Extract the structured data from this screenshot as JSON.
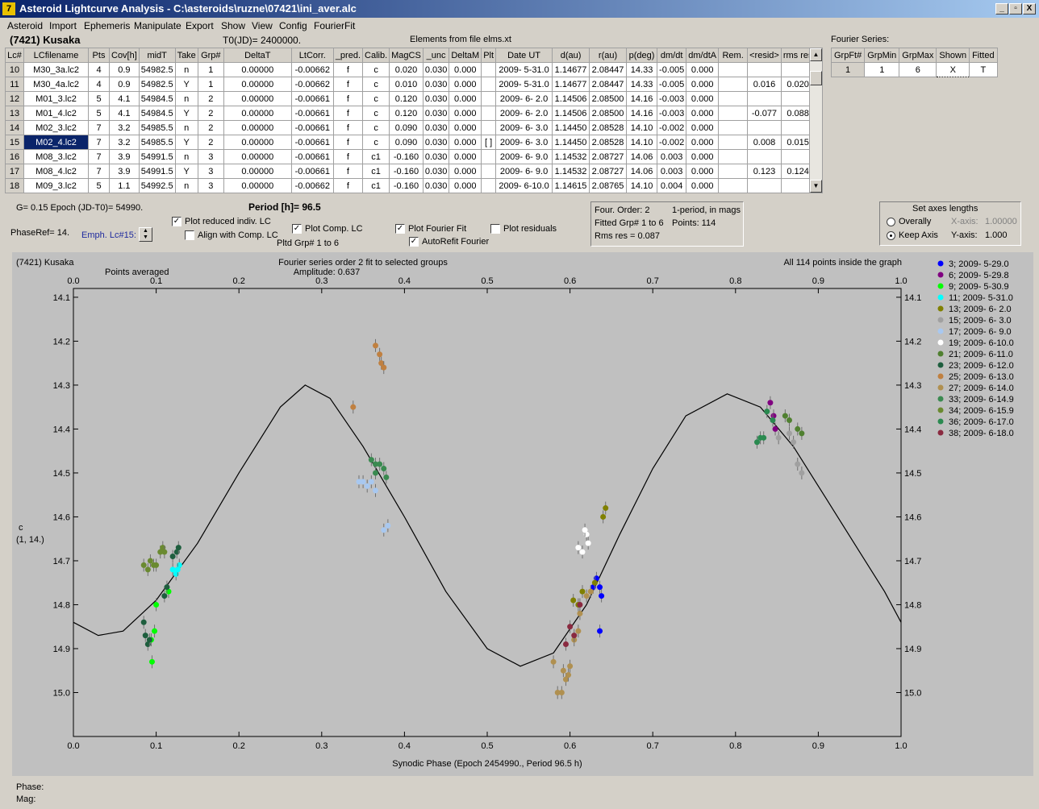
{
  "window": {
    "title": "Asteroid Lightcurve Analysis - C:\\asteroids\\ruzne\\07421\\ini_aver.alc",
    "minimize": "_",
    "maximize": "▫",
    "close": "X"
  },
  "menu": [
    "Asteroid",
    "Import",
    "Ephemeris",
    "Manipulate",
    "Export",
    "Show",
    "View",
    "Config",
    "FourierFit"
  ],
  "header": {
    "asteroid": "(7421) Kusaka",
    "t0": "T0(JD)= 2400000.",
    "elements": "Elements from file elms.xt",
    "fourier_series_label": "Fourier Series:"
  },
  "table": {
    "columns": [
      "Lc#",
      "LCfilename",
      "Pts",
      "Cov[h]",
      "midT",
      "Take",
      "Grp#",
      "DeltaT",
      "LtCorr.",
      "_pred.",
      "Calib.",
      "MagCS",
      "_unc",
      "DeltaM",
      "Plt",
      "Date UT",
      "d(au)",
      "r(au)",
      "p(deg)",
      "dm/dt",
      "dm/dtA",
      "Rem.",
      "<resid>",
      "rms res"
    ],
    "rows": [
      [
        "10",
        "M30_3a.lc2",
        "4",
        "0.9",
        "54982.5",
        "n",
        "1",
        "0.00000",
        "-0.00662",
        "f",
        "c",
        "0.020",
        "0.030",
        "0.000",
        "",
        "2009- 5-31.0",
        "1.14677",
        "2.08447",
        "14.33",
        "-0.005",
        "0.000",
        "",
        "",
        ""
      ],
      [
        "11",
        "M30_4a.lc2",
        "4",
        "0.9",
        "54982.5",
        "Y",
        "1",
        "0.00000",
        "-0.00662",
        "f",
        "c",
        "0.010",
        "0.030",
        "0.000",
        "",
        "2009- 5-31.0",
        "1.14677",
        "2.08447",
        "14.33",
        "-0.005",
        "0.000",
        "",
        "0.016",
        "0.020"
      ],
      [
        "12",
        "M01_3.lc2",
        "5",
        "4.1",
        "54984.5",
        "n",
        "2",
        "0.00000",
        "-0.00661",
        "f",
        "c",
        "0.120",
        "0.030",
        "0.000",
        "",
        "2009- 6- 2.0",
        "1.14506",
        "2.08500",
        "14.16",
        "-0.003",
        "0.000",
        "",
        "",
        ""
      ],
      [
        "13",
        "M01_4.lc2",
        "5",
        "4.1",
        "54984.5",
        "Y",
        "2",
        "0.00000",
        "-0.00661",
        "f",
        "c",
        "0.120",
        "0.030",
        "0.000",
        "",
        "2009- 6- 2.0",
        "1.14506",
        "2.08500",
        "14.16",
        "-0.003",
        "0.000",
        "",
        "-0.077",
        "0.088"
      ],
      [
        "14",
        "M02_3.lc2",
        "7",
        "3.2",
        "54985.5",
        "n",
        "2",
        "0.00000",
        "-0.00661",
        "f",
        "c",
        "0.090",
        "0.030",
        "0.000",
        "",
        "2009- 6- 3.0",
        "1.14450",
        "2.08528",
        "14.10",
        "-0.002",
        "0.000",
        "",
        "",
        ""
      ],
      [
        "15",
        "M02_4.lc2",
        "7",
        "3.2",
        "54985.5",
        "Y",
        "2",
        "0.00000",
        "-0.00661",
        "f",
        "c",
        "0.090",
        "0.030",
        "0.000",
        "[ ]",
        "2009- 6- 3.0",
        "1.14450",
        "2.08528",
        "14.10",
        "-0.002",
        "0.000",
        "",
        "0.008",
        "0.015"
      ],
      [
        "16",
        "M08_3.lc2",
        "7",
        "3.9",
        "54991.5",
        "n",
        "3",
        "0.00000",
        "-0.00661",
        "f",
        "c1",
        "-0.160",
        "0.030",
        "0.000",
        "",
        "2009- 6- 9.0",
        "1.14532",
        "2.08727",
        "14.06",
        "0.003",
        "0.000",
        "",
        "",
        ""
      ],
      [
        "17",
        "M08_4.lc2",
        "7",
        "3.9",
        "54991.5",
        "Y",
        "3",
        "0.00000",
        "-0.00661",
        "f",
        "c1",
        "-0.160",
        "0.030",
        "0.000",
        "",
        "2009- 6- 9.0",
        "1.14532",
        "2.08727",
        "14.06",
        "0.003",
        "0.000",
        "",
        "0.123",
        "0.124"
      ],
      [
        "18",
        "M09_3.lc2",
        "5",
        "1.1",
        "54992.5",
        "n",
        "3",
        "0.00000",
        "-0.00662",
        "f",
        "c1",
        "-0.160",
        "0.030",
        "0.000",
        "",
        "2009- 6-10.0",
        "1.14615",
        "2.08765",
        "14.10",
        "0.004",
        "0.000",
        "",
        "",
        ""
      ]
    ],
    "selected_row": "15"
  },
  "fourier_table": {
    "columns": [
      "GrpFt#",
      "GrpMin",
      "GrpMax",
      "Shown",
      "Fitted"
    ],
    "row": [
      "1",
      "1",
      "6",
      "X",
      "T"
    ]
  },
  "controls": {
    "g_epoch": "G= 0.15   Epoch (JD-T0)= 54990.",
    "period": "Period [h]= 96.5",
    "phaseref": "PhaseRef= 14.",
    "emph": "Emph. Lc#15:",
    "plot_reduced": "Plot reduced indiv. LC",
    "align_comp": "Align with Comp. LC",
    "plot_comp": "Plot Comp. LC",
    "pltd_grp": "Pltd Grp#  1   to    6",
    "plot_fourier": "Plot Fourier Fit",
    "autorefit": "AutoRefit Fourier",
    "plot_residuals": "Plot residuals",
    "check_mark": "✓"
  },
  "fit_info": {
    "order": "Four. Order:  2",
    "period_mode": "1-period, in mags",
    "fitted": "Fitted Grp# 1 to 6",
    "points": "Points: 114",
    "rms": "Rms res     = 0.087"
  },
  "axes_box": {
    "title": "Set axes lengths",
    "overally": "Overally",
    "keep_axis": "Keep Axis",
    "xaxis_label": "X-axis:",
    "xaxis_value": "1.00000",
    "yaxis_label": "Y-axis:",
    "yaxis_value": "1.000"
  },
  "status": {
    "phase": "Phase:",
    "mag": "Mag:"
  },
  "chart_data": {
    "type": "scatter",
    "top_left": "(7421) Kusaka",
    "points_averaged": "Points averaged",
    "title": "Fourier series order 2 fit to selected groups",
    "subtitle": "Amplitude: 0.637",
    "top_right": "All 114 points inside the graph",
    "xlabel": "Synodic Phase (Epoch 2454990., Period 96.5 h)",
    "ylabel": "c",
    "ylabel2": "(1, 14.)",
    "xlim": [
      0.0,
      1.0
    ],
    "ylim": [
      15.1,
      14.08
    ],
    "x_ticks": [
      "0.0",
      "0.1",
      "0.2",
      "0.3",
      "0.4",
      "0.5",
      "0.6",
      "0.7",
      "0.8",
      "0.9",
      "1.0"
    ],
    "y_ticks": [
      "14.1",
      "14.2",
      "14.3",
      "14.4",
      "14.5",
      "14.6",
      "14.7",
      "14.8",
      "14.9",
      "15.0"
    ],
    "fourier_curve": [
      [
        0.0,
        14.84
      ],
      [
        0.03,
        14.87
      ],
      [
        0.06,
        14.86
      ],
      [
        0.1,
        14.79
      ],
      [
        0.15,
        14.66
      ],
      [
        0.2,
        14.5
      ],
      [
        0.25,
        14.35
      ],
      [
        0.28,
        14.3
      ],
      [
        0.31,
        14.33
      ],
      [
        0.35,
        14.44
      ],
      [
        0.4,
        14.6
      ],
      [
        0.45,
        14.77
      ],
      [
        0.5,
        14.9
      ],
      [
        0.54,
        14.94
      ],
      [
        0.58,
        14.91
      ],
      [
        0.62,
        14.8
      ],
      [
        0.66,
        14.64
      ],
      [
        0.7,
        14.49
      ],
      [
        0.74,
        14.37
      ],
      [
        0.79,
        14.32
      ],
      [
        0.83,
        14.35
      ],
      [
        0.87,
        14.44
      ],
      [
        0.91,
        14.56
      ],
      [
        0.95,
        14.68
      ],
      [
        0.98,
        14.77
      ],
      [
        1.0,
        14.84
      ]
    ],
    "series": [
      {
        "name": "3; 2009- 5-29.0",
        "color": "#0000ff",
        "points": [
          [
            0.632,
            14.74
          ],
          [
            0.636,
            14.76
          ],
          [
            0.638,
            14.78
          ],
          [
            0.636,
            14.86
          ],
          [
            0.628,
            14.76
          ]
        ]
      },
      {
        "name": "6; 2009- 5-29.8",
        "color": "#800080",
        "points": [
          [
            0.842,
            14.34
          ],
          [
            0.846,
            14.37
          ],
          [
            0.848,
            14.4
          ]
        ]
      },
      {
        "name": "9; 2009- 5-30.9",
        "color": "#00ff00",
        "points": [
          [
            0.095,
            14.93
          ],
          [
            0.098,
            14.86
          ],
          [
            0.1,
            14.8
          ],
          [
            0.094,
            14.88
          ],
          [
            0.115,
            14.77
          ]
        ]
      },
      {
        "name": "11; 2009- 5-31.0",
        "color": "#00ffff",
        "points": [
          [
            0.12,
            14.72
          ],
          [
            0.124,
            14.73
          ],
          [
            0.128,
            14.71
          ],
          [
            0.126,
            14.72
          ]
        ]
      },
      {
        "name": "13; 2009- 6- 2.0",
        "color": "#808000",
        "points": [
          [
            0.604,
            14.79
          ],
          [
            0.615,
            14.77
          ],
          [
            0.63,
            14.75
          ],
          [
            0.64,
            14.6
          ],
          [
            0.643,
            14.58
          ],
          [
            0.61,
            14.8
          ]
        ]
      },
      {
        "name": "15; 2009- 6- 3.0",
        "color": "#a0a0a0",
        "points": [
          [
            0.852,
            14.42
          ],
          [
            0.865,
            14.41
          ],
          [
            0.87,
            14.43
          ],
          [
            0.875,
            14.48
          ],
          [
            0.88,
            14.5
          ]
        ]
      },
      {
        "name": "17; 2009- 6- 9.0",
        "color": "#a8c8f0",
        "points": [
          [
            0.345,
            14.52
          ],
          [
            0.35,
            14.52
          ],
          [
            0.355,
            14.53
          ],
          [
            0.36,
            14.52
          ],
          [
            0.365,
            14.54
          ],
          [
            0.38,
            14.62
          ],
          [
            0.375,
            14.63
          ]
        ]
      },
      {
        "name": "19; 2009- 6-10.0",
        "color": "#ffffff",
        "points": [
          [
            0.61,
            14.67
          ],
          [
            0.615,
            14.68
          ],
          [
            0.62,
            14.64
          ],
          [
            0.618,
            14.63
          ],
          [
            0.622,
            14.66
          ]
        ]
      },
      {
        "name": "21; 2009- 6-11.0",
        "color": "#508030",
        "points": [
          [
            0.86,
            14.37
          ],
          [
            0.875,
            14.4
          ],
          [
            0.88,
            14.41
          ],
          [
            0.865,
            14.38
          ]
        ]
      },
      {
        "name": "23; 2009- 6-12.0",
        "color": "#1e5e3e",
        "points": [
          [
            0.085,
            14.84
          ],
          [
            0.087,
            14.87
          ],
          [
            0.09,
            14.89
          ],
          [
            0.092,
            14.88
          ],
          [
            0.11,
            14.78
          ],
          [
            0.12,
            14.69
          ],
          [
            0.125,
            14.68
          ],
          [
            0.127,
            14.67
          ],
          [
            0.113,
            14.76
          ]
        ]
      },
      {
        "name": "25; 2009- 6-13.0",
        "color": "#c08040",
        "points": [
          [
            0.338,
            14.35
          ],
          [
            0.365,
            14.21
          ],
          [
            0.37,
            14.23
          ],
          [
            0.372,
            14.25
          ],
          [
            0.375,
            14.26
          ]
        ]
      },
      {
        "name": "27; 2009- 6-14.0",
        "color": "#b09050",
        "points": [
          [
            0.58,
            14.93
          ],
          [
            0.585,
            15.0
          ],
          [
            0.59,
            15.0
          ],
          [
            0.592,
            14.95
          ],
          [
            0.6,
            14.94
          ],
          [
            0.595,
            14.97
          ],
          [
            0.598,
            14.96
          ],
          [
            0.605,
            14.88
          ],
          [
            0.61,
            14.86
          ],
          [
            0.612,
            14.82
          ],
          [
            0.62,
            14.78
          ],
          [
            0.625,
            14.77
          ]
        ]
      },
      {
        "name": "33; 2009- 6-14.9",
        "color": "#3a8a50",
        "points": [
          [
            0.36,
            14.47
          ],
          [
            0.365,
            14.48
          ],
          [
            0.37,
            14.48
          ],
          [
            0.375,
            14.49
          ],
          [
            0.378,
            14.51
          ],
          [
            0.365,
            14.5
          ]
        ]
      },
      {
        "name": "34; 2009- 6-15.9",
        "color": "#6a8a30",
        "points": [
          [
            0.085,
            14.71
          ],
          [
            0.09,
            14.72
          ],
          [
            0.093,
            14.7
          ],
          [
            0.097,
            14.71
          ],
          [
            0.1,
            14.71
          ],
          [
            0.105,
            14.68
          ],
          [
            0.108,
            14.67
          ],
          [
            0.11,
            14.68
          ]
        ]
      },
      {
        "name": "36; 2009- 6-17.0",
        "color": "#2a8a50",
        "points": [
          [
            0.826,
            14.43
          ],
          [
            0.83,
            14.42
          ],
          [
            0.834,
            14.42
          ],
          [
            0.838,
            14.36
          ],
          [
            0.845,
            14.38
          ]
        ]
      },
      {
        "name": "38; 2009- 6-18.0",
        "color": "#8a2a40",
        "points": [
          [
            0.595,
            14.89
          ],
          [
            0.6,
            14.85
          ],
          [
            0.605,
            14.87
          ],
          [
            0.612,
            14.8
          ]
        ]
      }
    ]
  }
}
